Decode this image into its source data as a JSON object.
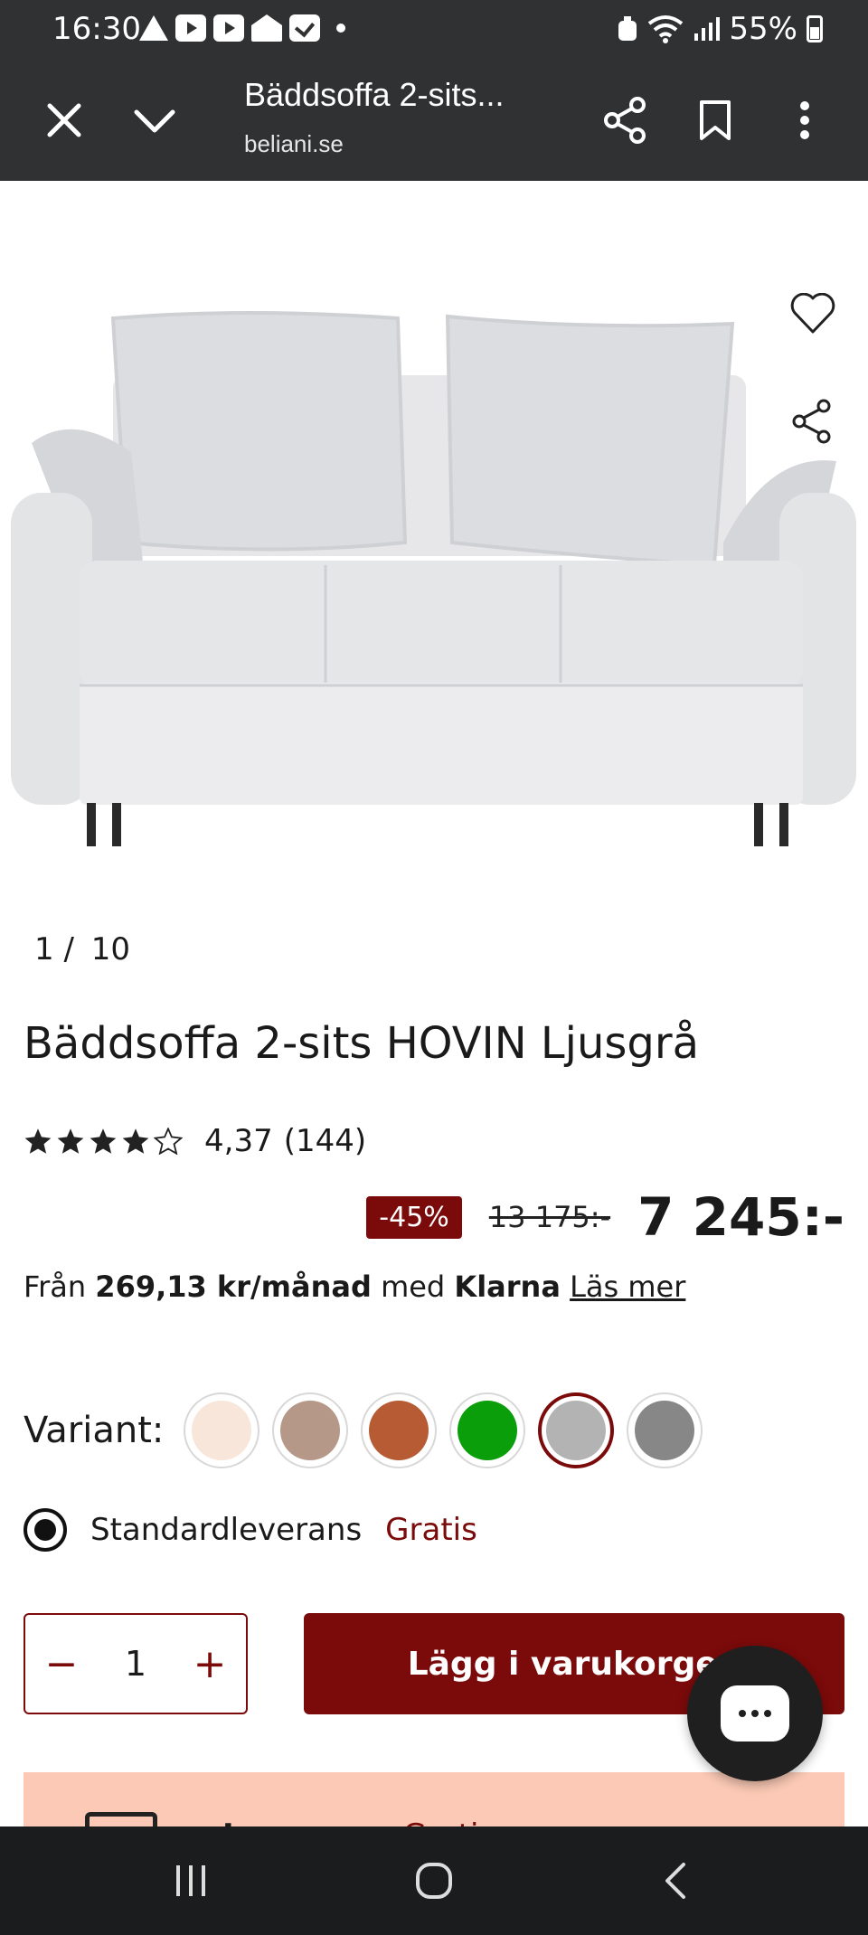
{
  "status_bar": {
    "time": "16:30",
    "battery": "55%",
    "notification_icons": [
      "warning-icon",
      "youtube-icon",
      "youtube-icon",
      "home-icon",
      "check-icon",
      "dot-icon"
    ]
  },
  "browser": {
    "title": "Bäddsoffa 2-sits...",
    "url": "beliani.se"
  },
  "gallery": {
    "counter_current": "1",
    "counter_sep": "/",
    "counter_total": "10"
  },
  "product": {
    "title": "Bäddsoffa 2-sits HOVIN Ljusgrå",
    "rating_value": "4,37",
    "rating_count": "(144)",
    "rating_stars": 4.37,
    "discount": "-45%",
    "old_price": "13 175:-",
    "price": "7 245:-"
  },
  "klarna": {
    "prefix": "Från",
    "amount": "269,13 kr/månad",
    "mid": "med",
    "brand": "Klarna",
    "link": "Läs mer"
  },
  "variant": {
    "label": "Variant:",
    "swatches": [
      "#f7e6d9",
      "#b59888",
      "#b65b33",
      "#0a9e0a",
      "#b3b3b3",
      "#878787"
    ],
    "selected_index": 4
  },
  "delivery": {
    "label": "Standardleverans",
    "price": "Gratis"
  },
  "cart": {
    "minus": "−",
    "quantity": "1",
    "plus": "+",
    "add_label": "Lägg i varukorgen"
  },
  "delivery_bar": {
    "label": "Leverans:",
    "value": "Gratis"
  },
  "colors": {
    "accent": "#7b0a0a",
    "toolbar": "#303133",
    "delivery_bar": "#fbc9b5"
  }
}
